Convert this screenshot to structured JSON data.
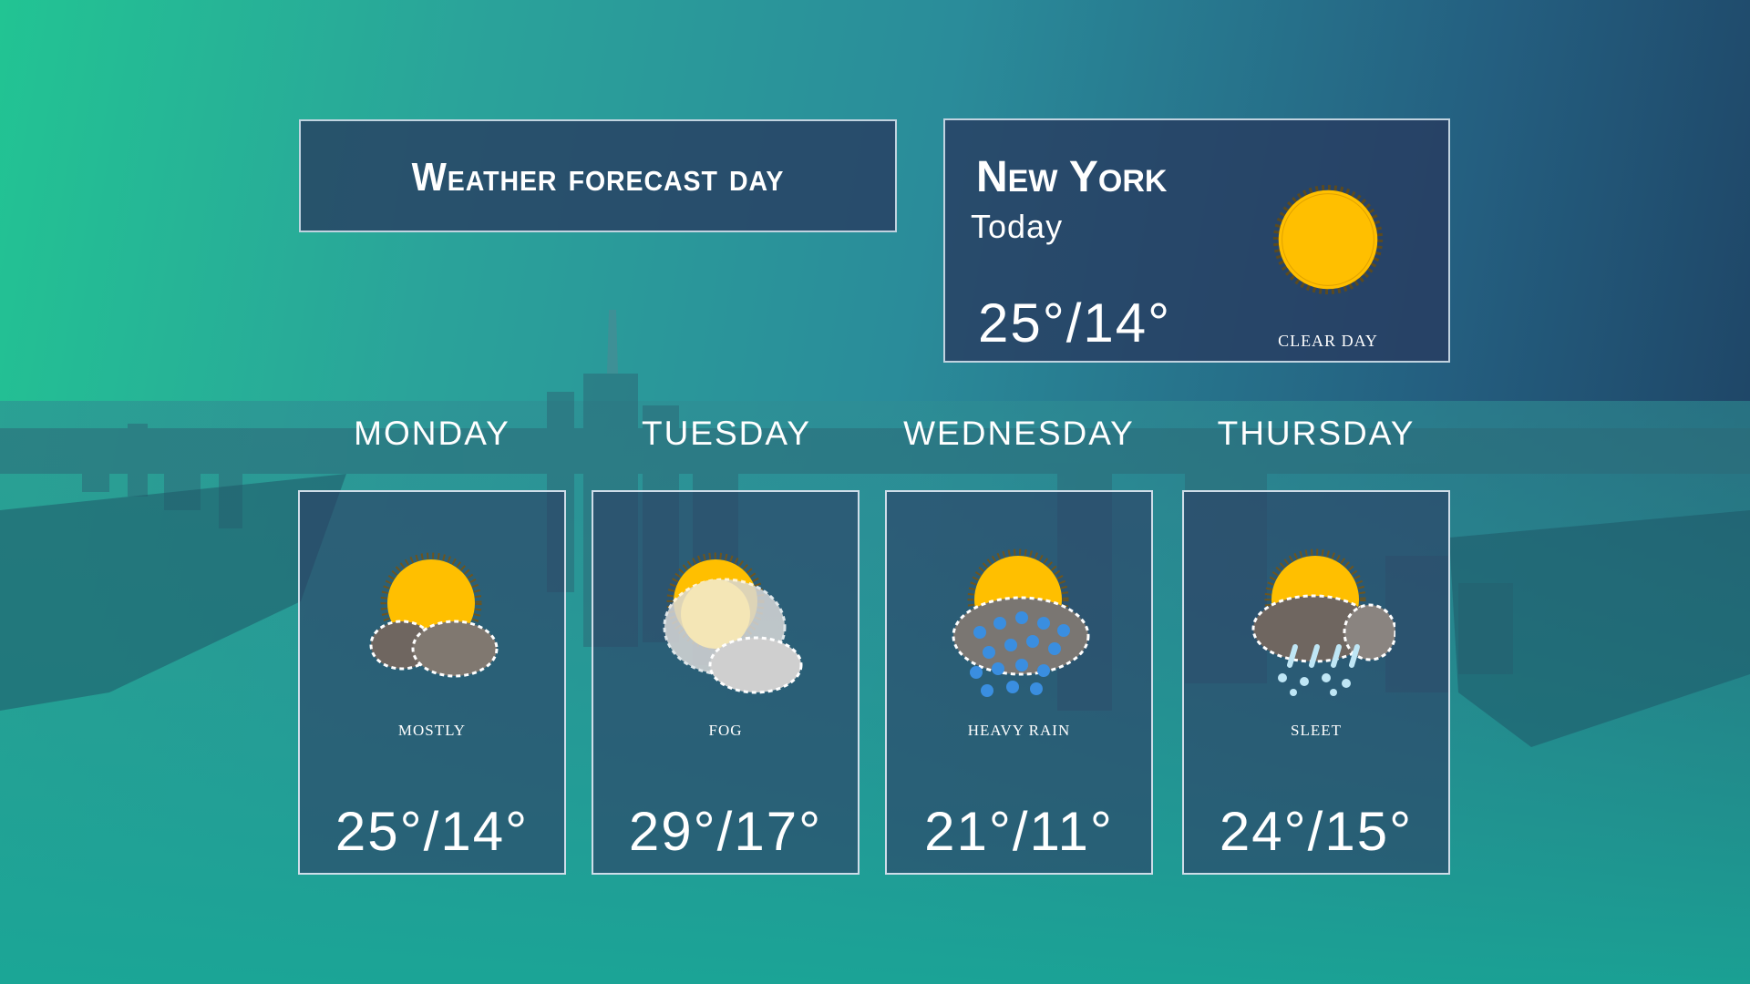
{
  "title": "Weather forecast day",
  "today": {
    "city": "New York",
    "label": "Today",
    "temp": "25°/14°",
    "condition": "CLEAR DAY",
    "icon": "sun-icon"
  },
  "days": [
    {
      "name": "MONDAY",
      "condition": "MOSTLY",
      "temp": "25°/14°",
      "icon": "partly-cloudy-icon"
    },
    {
      "name": "TUESDAY",
      "condition": "FOG",
      "temp": "29°/17°",
      "icon": "fog-icon"
    },
    {
      "name": "WEDNESDAY",
      "condition": "HEAVY RAIN",
      "temp": "21°/11°",
      "icon": "heavy-rain-icon"
    },
    {
      "name": "THURSDAY",
      "condition": "SLEET",
      "temp": "24°/15°",
      "icon": "sleet-icon"
    }
  ],
  "colors": {
    "sun": "#ffbf00",
    "panel": "#2c3e63",
    "background_left": "#22c493",
    "background_right": "#1d3f60"
  }
}
